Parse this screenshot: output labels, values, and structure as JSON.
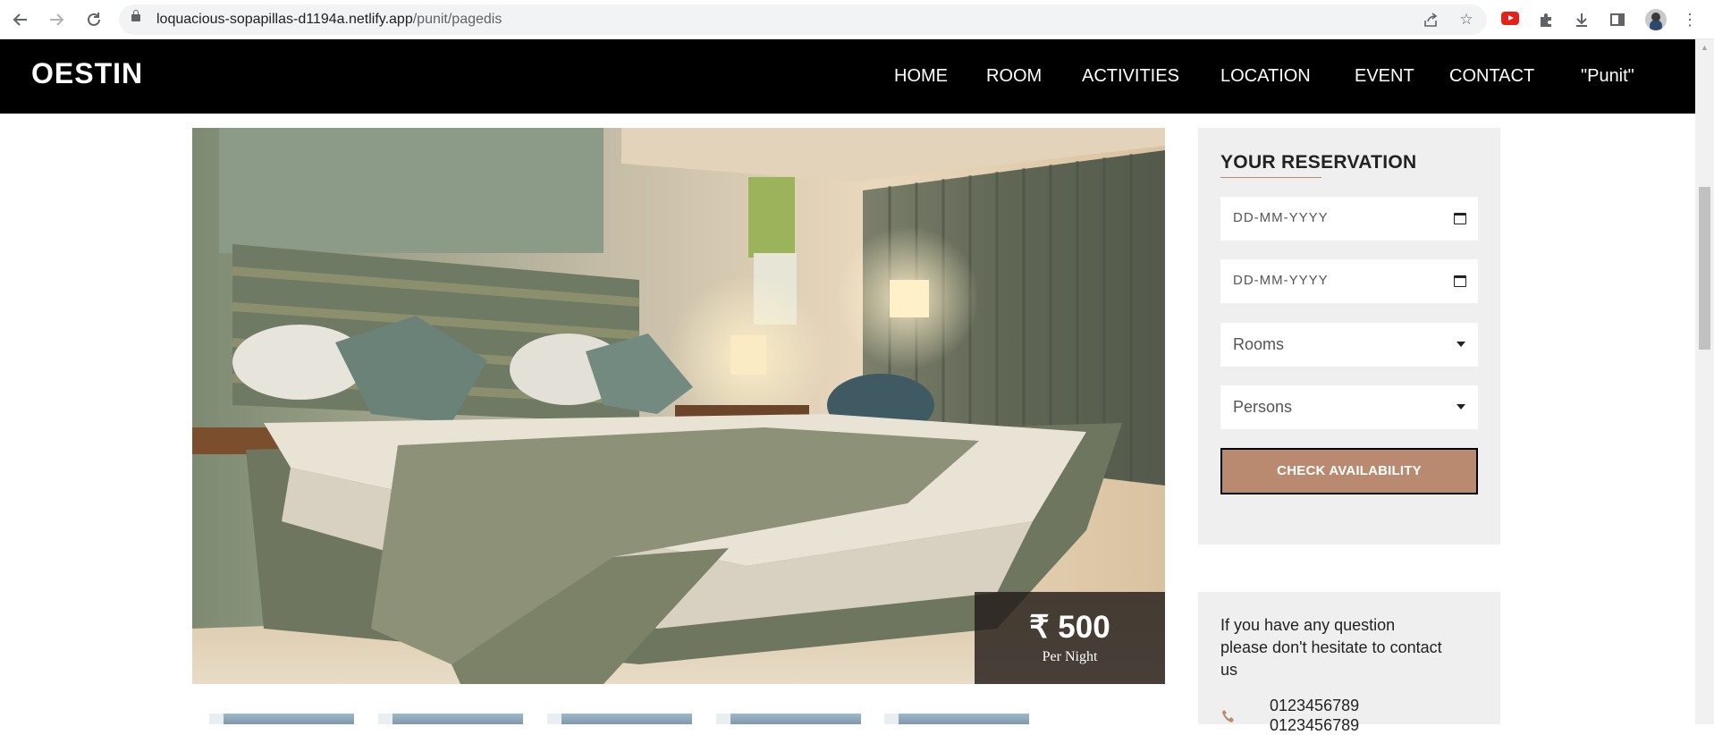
{
  "browser": {
    "url_host": "loquacious-sopapillas-d1194a.netlify.app",
    "url_path": "/punit/pagedis"
  },
  "site": {
    "logo": "OESTIN",
    "menu": [
      "HOME",
      "ROOM",
      "ACTIVITIES",
      "LOCATION",
      "EVENT",
      "CONTACT",
      "\"Punit\""
    ]
  },
  "room": {
    "price": "₹ 500",
    "price_unit": "Per Night"
  },
  "reservation": {
    "title": "YOUR RESERVATION",
    "checkin_placeholder": "DD-MM-YYYY",
    "checkout_placeholder": "DD-MM-YYYY",
    "rooms_select": "Rooms",
    "persons_select": "Persons",
    "check_button": "CHECK AVAILABILITY"
  },
  "contact": {
    "text": "If you have any question please don't hesitate to contact us",
    "phones": [
      "0123456789",
      "0123456789"
    ]
  },
  "colors": {
    "accent": "#b98a70",
    "header_bg": "#000000",
    "panel_bg": "#efefef"
  }
}
